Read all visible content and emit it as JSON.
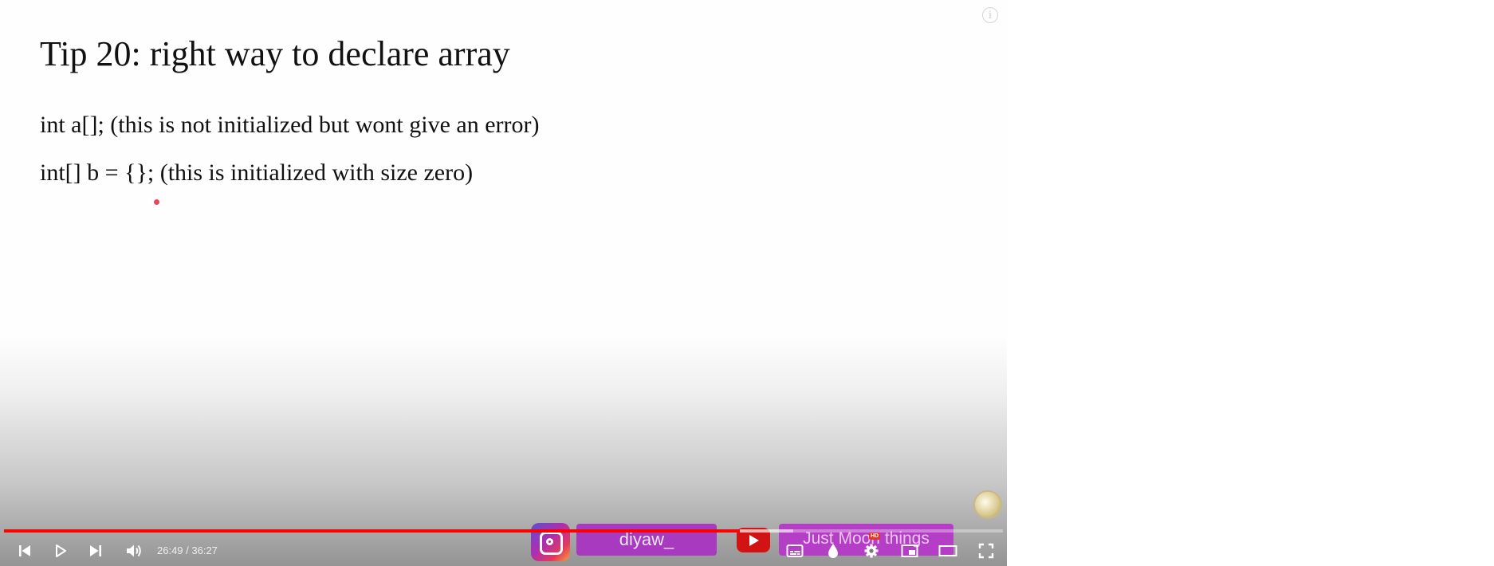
{
  "slide": {
    "title": "Tip 20: right way to declare array",
    "lines": [
      "int a[]; (this is not initialized but wont give an error)",
      "int[] b = {}; (this is initialized with size zero)"
    ]
  },
  "overlays": {
    "instagram_icon": "instagram-icon",
    "instagram_handle": "diyaw_",
    "youtube_icon": "youtube-icon",
    "channel_name": "Just Moon things"
  },
  "player": {
    "time_display": "26:49 / 36:27",
    "progress_fraction": 0.737,
    "buffered_fraction": 0.79,
    "quality_badge": "HD",
    "accent_color": "#ff0000",
    "icons": [
      "previous-icon",
      "play-icon",
      "next-icon",
      "volume-icon",
      "subtitles-icon",
      "drop-icon",
      "settings-icon",
      "miniplayer-icon",
      "theater-mode-icon",
      "fullscreen-icon",
      "info-icon"
    ]
  }
}
